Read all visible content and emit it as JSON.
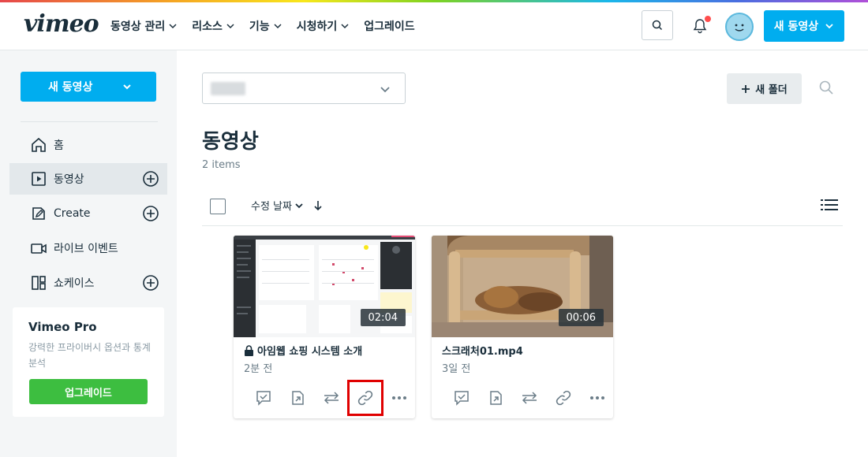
{
  "header": {
    "logo": "vimeo",
    "nav": [
      {
        "label": "동영상 관리"
      },
      {
        "label": "리소스"
      },
      {
        "label": "기능"
      },
      {
        "label": "시청하기"
      },
      {
        "label": "업그레이드"
      }
    ],
    "new_video_label": "새 동영상"
  },
  "sidebar": {
    "new_video_label": "새 동영상",
    "items": [
      {
        "label": "홈",
        "icon": "home-icon"
      },
      {
        "label": "동영상",
        "icon": "video-icon"
      },
      {
        "label": "Create",
        "icon": "create-icon"
      },
      {
        "label": "라이브 이벤트",
        "icon": "live-camera-icon"
      },
      {
        "label": "쇼케이스",
        "icon": "showcase-icon"
      }
    ],
    "pro": {
      "title": "Vimeo Pro",
      "desc": "강력한 프라이버시 옵션과 통계 분석",
      "button": "업그레이드"
    }
  },
  "main": {
    "title": "동영상",
    "count": "2 items",
    "new_folder_label": "새 폴더",
    "sort_label": "수정 날짜",
    "videos": [
      {
        "title": "아임웹 쇼핑 시스템 소개",
        "time": "2분 전",
        "duration": "02:04",
        "locked": true
      },
      {
        "title": "스크래처01.mp4",
        "time": "3일 전",
        "duration": "00:06",
        "locked": false
      }
    ]
  },
  "colors": {
    "accent": "#00adef",
    "upgrade": "#3dbe40",
    "highlight": "#e00000"
  }
}
